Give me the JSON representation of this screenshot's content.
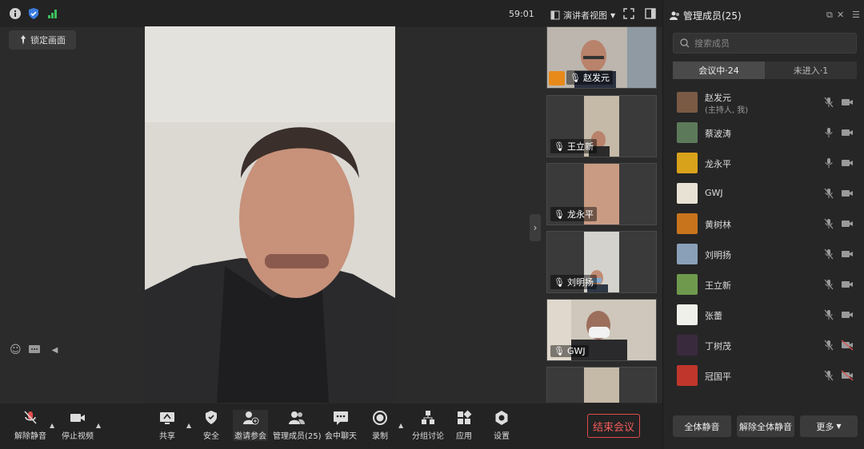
{
  "topbar": {
    "timer": "59:01",
    "view_label": "演讲者视图",
    "lock_label": "锁定画面"
  },
  "thumbnails": [
    {
      "name": "赵发元",
      "host": true
    },
    {
      "name": "王立新"
    },
    {
      "name": "龙永平"
    },
    {
      "name": "刘明扬"
    },
    {
      "name": "GWJ"
    },
    {
      "name": ""
    }
  ],
  "toolbar": {
    "unmute": "解除静音",
    "stop_video": "停止视频",
    "share": "共享",
    "security": "安全",
    "invite": "邀请参会",
    "manage": "管理成员(25)",
    "chat": "会中聊天",
    "record": "录制",
    "breakout": "分组讨论",
    "apps": "应用",
    "settings": "设置",
    "end": "结束会议"
  },
  "panel": {
    "title": "管理成员(25)",
    "search_placeholder": "搜索成员",
    "tab_in": "会议中·24",
    "tab_out": "未进入·1",
    "members": [
      {
        "name": "赵发元",
        "sub": "(主持人, 我)",
        "mic": "muted",
        "cam": "on",
        "color": "#7a5a44"
      },
      {
        "name": "蔡波涛",
        "mic": "on",
        "cam": "on",
        "color": "#5c7a5a"
      },
      {
        "name": "龙永平",
        "mic": "on",
        "cam": "on",
        "color": "#d9a21b"
      },
      {
        "name": "GWJ",
        "mic": "muted",
        "cam": "on",
        "color": "#e8e2d4"
      },
      {
        "name": "黄树林",
        "mic": "muted",
        "cam": "on",
        "color": "#c8741c"
      },
      {
        "name": "刘明扬",
        "mic": "muted",
        "cam": "on",
        "color": "#8aa0b8"
      },
      {
        "name": "王立新",
        "mic": "muted",
        "cam": "on",
        "color": "#6f9a4d"
      },
      {
        "name": "张蕾",
        "mic": "muted",
        "cam": "on",
        "color": "#f0f0ea"
      },
      {
        "name": "丁树茂",
        "mic": "muted",
        "cam": "off",
        "color": "#3a2a3e"
      },
      {
        "name": "冠国平",
        "mic": "muted",
        "cam": "off",
        "color": "#c0362c"
      }
    ],
    "mute_all": "全体静音",
    "unmute_all": "解除全体静音",
    "more": "更多"
  }
}
